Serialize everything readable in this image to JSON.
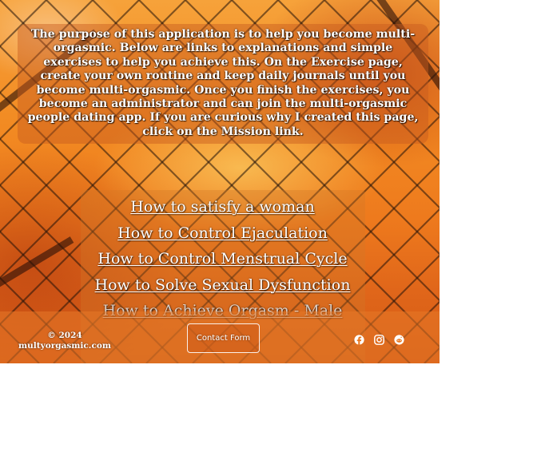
{
  "intro": {
    "text": "The purpose of this application is to help you become multi-orgasmic. Below are links to explanations and simple exercises to help you achieve this. On the Exercise page, create your own routine and keep daily journals until you become multi-orgasmic. Once you finish the exercises, you become an administrator and can join the multi-orgasmic people dating app. If you are curious why I created this page, click on the Mission link."
  },
  "links": [
    {
      "label": "How to satisfy a woman"
    },
    {
      "label": "How to Control Ejaculation"
    },
    {
      "label": "How to Control Menstrual Cycle"
    },
    {
      "label": "How to Solve Sexual Dysfunction"
    },
    {
      "label": "How to Achieve Orgasm - Male"
    }
  ],
  "footer": {
    "copyright_line1": "© 2024",
    "copyright_line2": "multyorgasmic.com",
    "contact_label": "Contact Form",
    "social_icons": [
      "facebook-icon",
      "instagram-icon",
      "reddit-icon"
    ]
  },
  "colors": {
    "background_orange": "#f28a22",
    "text": "#ffffff"
  }
}
